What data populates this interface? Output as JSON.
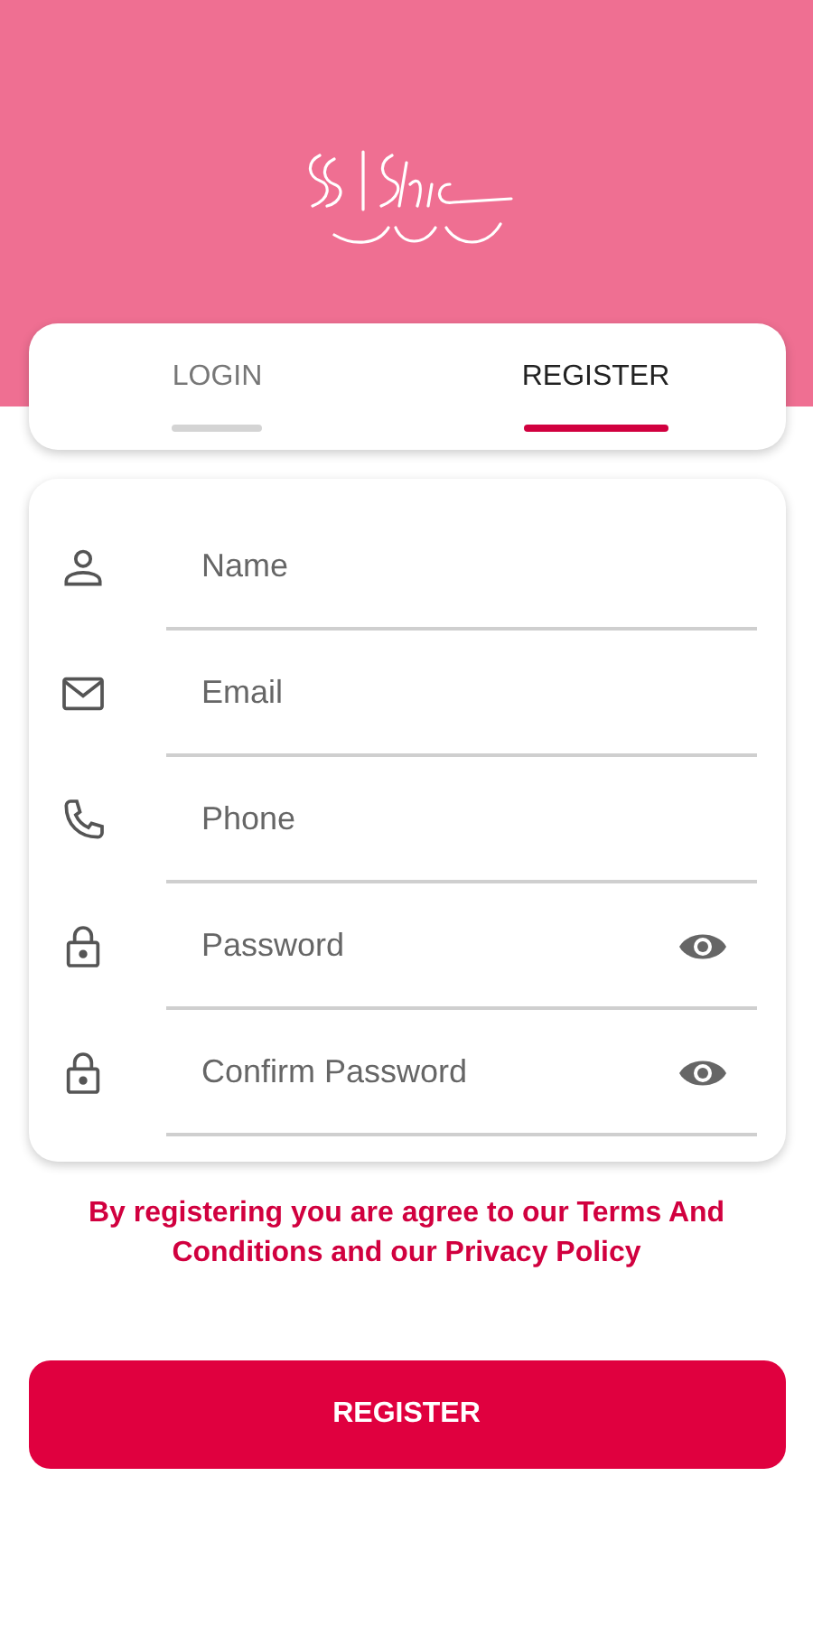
{
  "tabs": [
    {
      "label": "LOGIN",
      "selected": false
    },
    {
      "label": "REGISTER",
      "selected": true
    }
  ],
  "fields": [
    {
      "kind": "name",
      "placeholder": "Name"
    },
    {
      "kind": "email",
      "placeholder": "Email"
    },
    {
      "kind": "phone",
      "placeholder": "Phone"
    },
    {
      "kind": "password",
      "placeholder": "Password"
    },
    {
      "kind": "password",
      "placeholder": "Confirm Password"
    }
  ],
  "terms": "By registering you are agree to our Terms And Conditions and our Privacy Policy",
  "submit": "REGISTER"
}
